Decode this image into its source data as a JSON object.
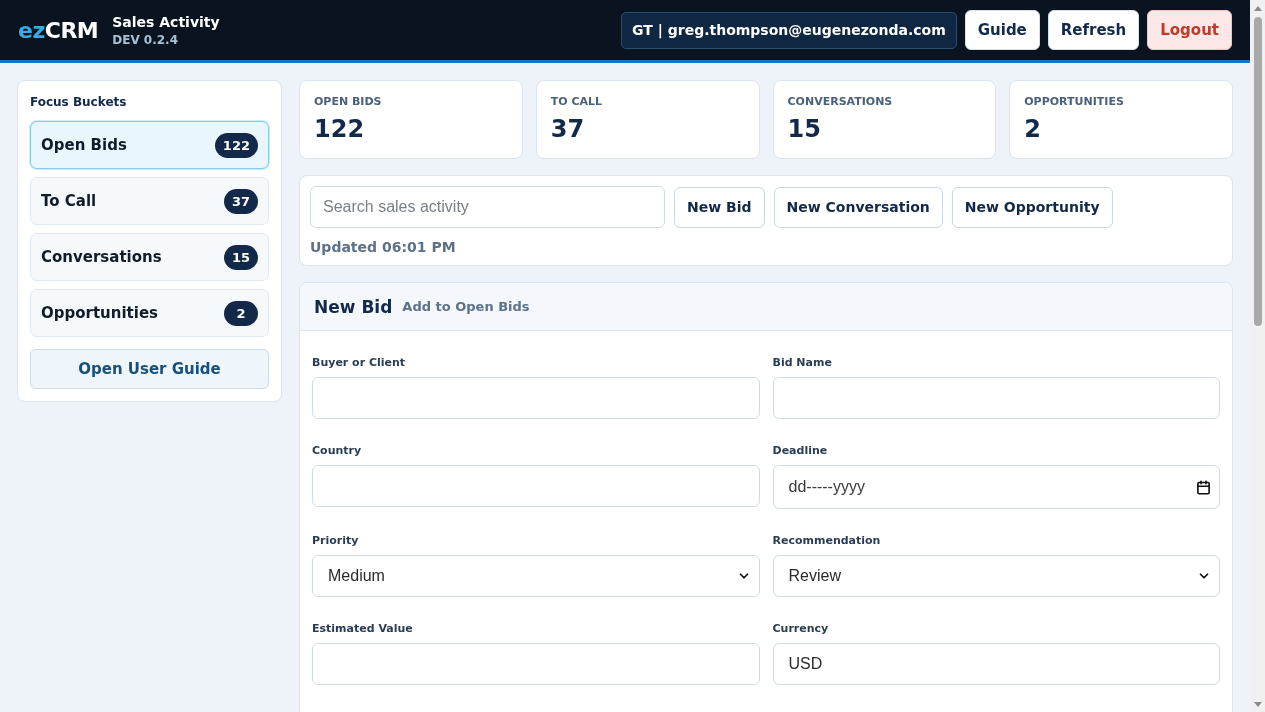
{
  "header": {
    "logo": {
      "accent": "ez",
      "text": "CRM"
    },
    "title": "Sales Activity",
    "version": "DEV 0.2.4",
    "user": "GT | greg.thompson@eugenezonda.com",
    "buttons": [
      {
        "label": "Guide",
        "kind": "default"
      },
      {
        "label": "Refresh",
        "kind": "default"
      },
      {
        "label": "Logout",
        "kind": "danger"
      }
    ]
  },
  "sidebar": {
    "title": "Focus Buckets",
    "items": [
      {
        "label": "Open Bids",
        "count": "122",
        "selected": true
      },
      {
        "label": "To Call",
        "count": "37",
        "selected": false
      },
      {
        "label": "Conversations",
        "count": "15",
        "selected": false
      },
      {
        "label": "Opportunities",
        "count": "2",
        "selected": false
      }
    ],
    "guide_button": "Open User Guide"
  },
  "stats": [
    {
      "label": "OPEN BIDS",
      "value": "122"
    },
    {
      "label": "TO CALL",
      "value": "37"
    },
    {
      "label": "CONVERSATIONS",
      "value": "15"
    },
    {
      "label": "OPPORTUNITIES",
      "value": "2"
    }
  ],
  "toolbar": {
    "search": {
      "placeholder": "Search sales activity"
    },
    "buttons": [
      "New Bid",
      "New Conversation",
      "New Opportunity"
    ],
    "updated": "Updated 06:01 PM"
  },
  "form": {
    "title": "New Bid",
    "subtitle": "Add to Open Bids",
    "fields": [
      {
        "label": "Buyer or Client",
        "kind": "text"
      },
      {
        "label": "Bid Name",
        "kind": "text"
      },
      {
        "label": "Country",
        "kind": "text"
      },
      {
        "label": "Deadline",
        "kind": "date",
        "placeholder": "dd-----yyyy"
      },
      {
        "label": "Priority",
        "kind": "select",
        "value": "Medium"
      },
      {
        "label": "Recommendation",
        "kind": "select",
        "value": "Review"
      },
      {
        "label": "Estimated Value",
        "kind": "text"
      },
      {
        "label": "Currency",
        "kind": "text",
        "value": "USD"
      }
    ]
  }
}
